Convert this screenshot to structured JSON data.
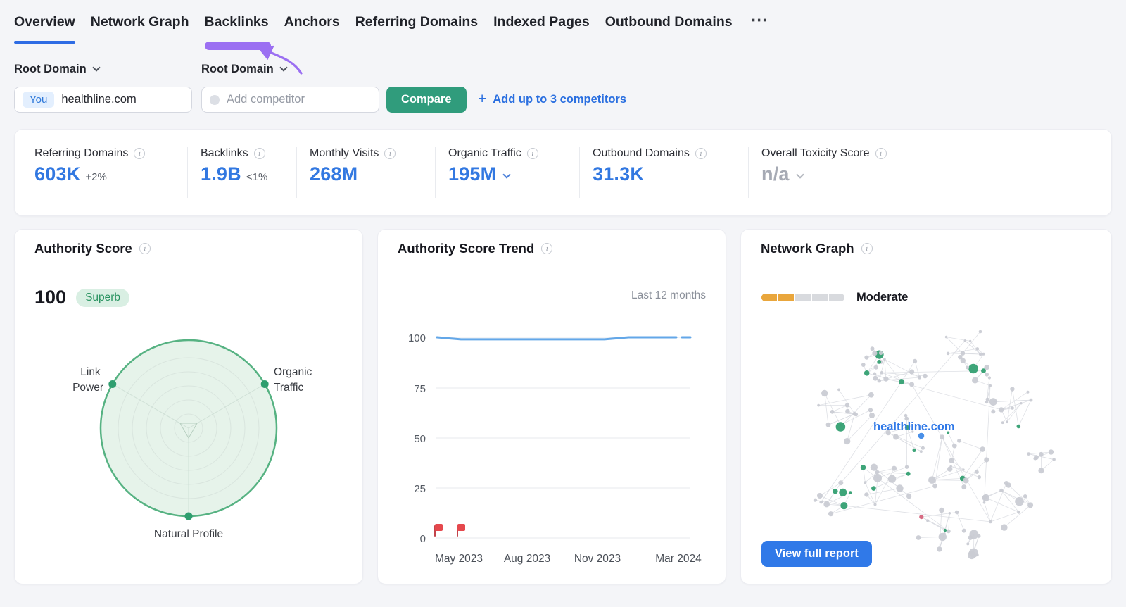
{
  "tabs": {
    "items": [
      {
        "label": "Overview",
        "active": true
      },
      {
        "label": "Network Graph"
      },
      {
        "label": "Backlinks",
        "annotated": true
      },
      {
        "label": "Anchors"
      },
      {
        "label": "Referring Domains"
      },
      {
        "label": "Indexed Pages"
      },
      {
        "label": "Outbound Domains"
      }
    ],
    "more_label": "⋯"
  },
  "filters": {
    "scope_you": "Root Domain",
    "scope_competitor": "Root Domain",
    "you_badge": "You",
    "you_value": "healthline.com",
    "competitor_placeholder": "Add competitor",
    "compare_label": "Compare",
    "add_competitors_label": "Add up to 3 competitors"
  },
  "metrics": [
    {
      "label": "Referring Domains",
      "value": "603K",
      "delta": "+2%"
    },
    {
      "label": "Backlinks",
      "value": "1.9B",
      "delta": "<1%"
    },
    {
      "label": "Monthly Visits",
      "value": "268M",
      "delta": ""
    },
    {
      "label": "Organic Traffic",
      "value": "195M",
      "delta": "",
      "has_dropdown": true
    },
    {
      "label": "Outbound Domains",
      "value": "31.3K",
      "delta": ""
    },
    {
      "label": "Overall Toxicity Score",
      "value": "n/a",
      "delta": "",
      "muted": true,
      "has_dropdown": true
    }
  ],
  "authority_card": {
    "title": "Authority Score",
    "score": "100",
    "badge": "Superb",
    "axes": [
      "Link Power",
      "Organic Traffic",
      "Natural Profile"
    ],
    "axes_lines": [
      [
        "Link",
        "Power"
      ],
      [
        "Organic",
        "Traffic"
      ],
      [
        "Natural Profile"
      ]
    ]
  },
  "trend_card": {
    "title": "Authority Score Trend",
    "range_label": "Last 12 months",
    "chart_data": {
      "type": "line",
      "title": "Authority Score Trend",
      "x_ticks": [
        "May 2023",
        "Aug 2023",
        "Nov 2023",
        "Mar 2024"
      ],
      "y_ticks": [
        0,
        25,
        50,
        75,
        100
      ],
      "ylim": [
        0,
        100
      ],
      "series": [
        {
          "name": "Authority Score",
          "values": [
            100,
            99,
            99,
            99,
            99,
            99,
            99,
            99,
            100,
            100,
            100,
            100
          ]
        }
      ],
      "gap_before_last": true,
      "line_color": "#63a7e8",
      "note_flag_markers_at_zero": 2,
      "grid": true,
      "legend_position": "none"
    }
  },
  "network_card": {
    "title": "Network Graph",
    "gauge_label": "Moderate",
    "gauge_filled_segments": 2,
    "gauge_total_segments": 5,
    "domain_label": "healthline.com",
    "button_label": "View full report"
  },
  "colors": {
    "accent_blue": "#2e6ce4",
    "metric_blue": "#3278e1",
    "compare_green": "#309c7c",
    "badge_green": "#27925f",
    "annotation_purple": "#9b6ff2",
    "flag_red": "#e5484d",
    "gauge_orange": "#e9a63c"
  }
}
